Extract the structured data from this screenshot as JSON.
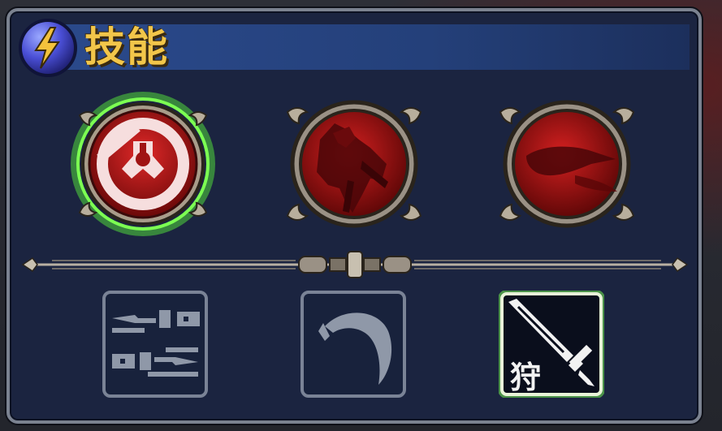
{
  "window": {
    "title": "技能",
    "title_color": "#f2c64a",
    "accent": "#2b4a8c"
  },
  "skills": [
    {
      "icon": "cleave-strike-icon",
      "selected": true
    },
    {
      "icon": "dark-summon-icon",
      "selected": false
    },
    {
      "icon": "shadow-dash-icon",
      "selected": false
    }
  ],
  "equipment_slots": [
    {
      "icon": "dual-blades-icon",
      "selected": false
    },
    {
      "icon": "scythe-claw-icon",
      "selected": false
    },
    {
      "icon": "hunter-sword-icon",
      "selected": true,
      "glyph": "狩"
    }
  ],
  "colors": {
    "selection_glow": "#6cff4a",
    "orb_red": "#c01818",
    "frame": "#9a9185"
  }
}
